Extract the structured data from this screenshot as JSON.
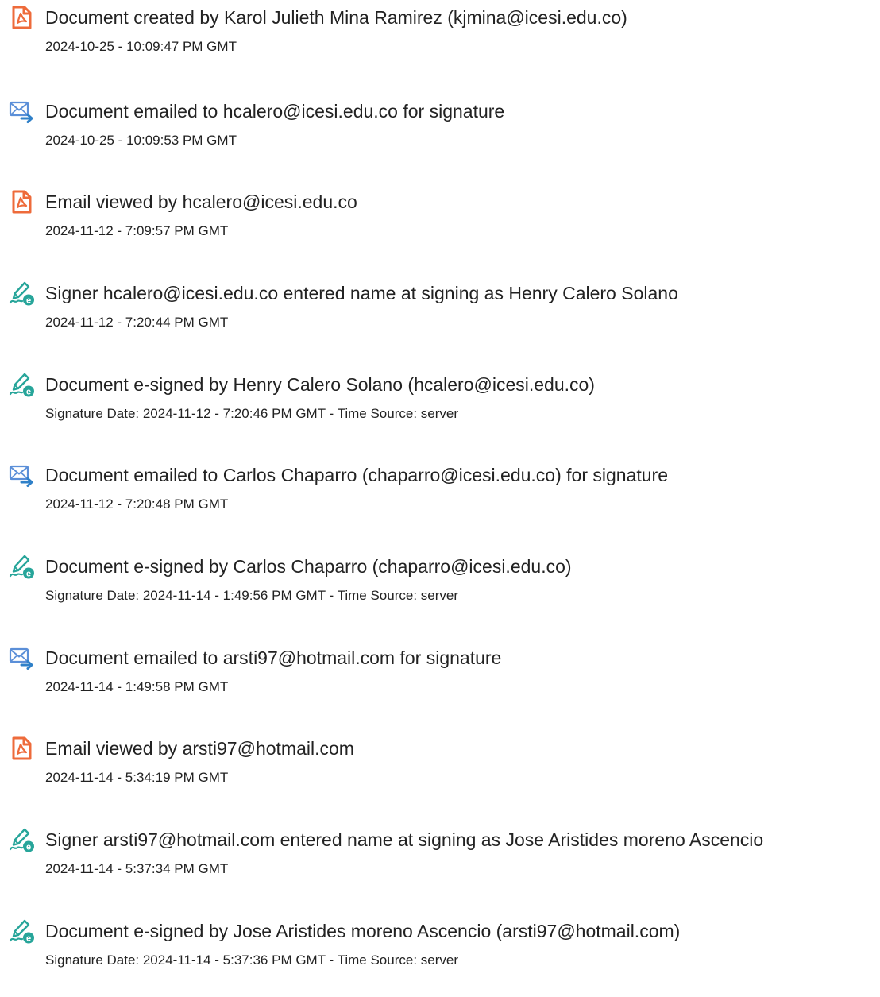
{
  "events": [
    {
      "icon": "pdf-document-icon",
      "title": "Document created by Karol Julieth Mina Ramirez (kjmina@icesi.edu.co)",
      "meta": "2024-10-25 - 10:09:47 PM GMT"
    },
    {
      "icon": "email-sent-icon",
      "title": "Document emailed to hcalero@icesi.edu.co for signature",
      "meta": "2024-10-25 - 10:09:53 PM GMT"
    },
    {
      "icon": "pdf-document-icon",
      "title": "Email viewed by hcalero@icesi.edu.co",
      "meta": "2024-11-12 - 7:09:57 PM GMT"
    },
    {
      "icon": "esign-pen-icon",
      "title": "Signer hcalero@icesi.edu.co entered name at signing as Henry Calero Solano",
      "meta": "2024-11-12 - 7:20:44 PM GMT"
    },
    {
      "icon": "esign-pen-icon",
      "title": "Document e-signed by Henry Calero Solano (hcalero@icesi.edu.co)",
      "meta": "Signature Date: 2024-11-12 - 7:20:46 PM GMT - Time Source: server"
    },
    {
      "icon": "email-sent-icon",
      "title": "Document emailed to Carlos Chaparro (chaparro@icesi.edu.co) for signature",
      "meta": "2024-11-12 - 7:20:48 PM GMT"
    },
    {
      "icon": "esign-pen-icon",
      "title": "Document e-signed by Carlos Chaparro (chaparro@icesi.edu.co)",
      "meta": "Signature Date: 2024-11-14 - 1:49:56 PM GMT - Time Source: server"
    },
    {
      "icon": "email-sent-icon",
      "title": "Document emailed to arsti97@hotmail.com for signature",
      "meta": "2024-11-14 - 1:49:58 PM GMT"
    },
    {
      "icon": "pdf-document-icon",
      "title": "Email viewed by arsti97@hotmail.com",
      "meta": "2024-11-14 - 5:34:19 PM GMT"
    },
    {
      "icon": "esign-pen-icon",
      "title": "Signer arsti97@hotmail.com entered name at signing as Jose Aristides moreno Ascencio",
      "meta": "2024-11-14 - 5:37:34 PM GMT"
    },
    {
      "icon": "esign-pen-icon",
      "title": "Document e-signed by Jose Aristides moreno Ascencio (arsti97@hotmail.com)",
      "meta": "Signature Date: 2024-11-14 - 5:37:36 PM GMT - Time Source: server"
    }
  ],
  "colors": {
    "document_icon": "#ee6b3b",
    "email_icon": "#5b8fd8",
    "email_arrow": "#2f80c8",
    "pen_icon": "#27a59a",
    "text": "#222222"
  }
}
